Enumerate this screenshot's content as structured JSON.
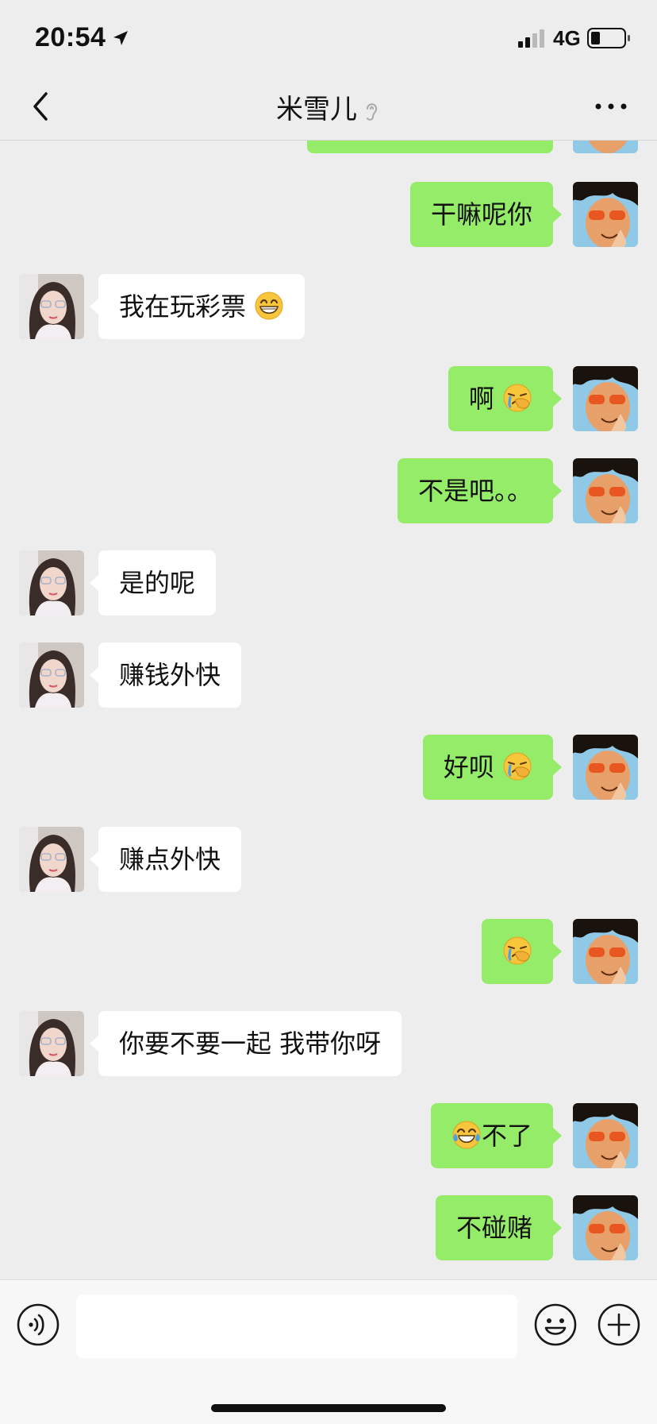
{
  "status_bar": {
    "time": "20:54",
    "network": "4G",
    "icons": [
      "location-arrow-icon",
      "signal-icon",
      "battery-icon"
    ]
  },
  "nav": {
    "title": "米雪儿",
    "icons": [
      "back-chevron-icon",
      "ear-icon",
      "more-dots-icon"
    ]
  },
  "messages": [
    {
      "side": "out",
      "text": "",
      "emoji": ""
    },
    {
      "side": "out",
      "text": "干嘛呢你",
      "emoji": ""
    },
    {
      "side": "in",
      "text": "我在玩彩票",
      "emoji": "grin"
    },
    {
      "side": "out",
      "text": "啊",
      "emoji": "facepalm"
    },
    {
      "side": "out",
      "text": "不是吧。。",
      "emoji": ""
    },
    {
      "side": "in",
      "text": "是的呢",
      "emoji": ""
    },
    {
      "side": "in",
      "text": "赚钱外快",
      "emoji": ""
    },
    {
      "side": "out",
      "text": "好呗",
      "emoji": "facepalm"
    },
    {
      "side": "in",
      "text": "赚点外快",
      "emoji": ""
    },
    {
      "side": "out",
      "text": "",
      "emoji": "facepalm"
    },
    {
      "side": "in",
      "text": "你要不要一起 我带你呀",
      "emoji": ""
    },
    {
      "side": "out",
      "text": "不了",
      "emoji": "tears-of-joy",
      "emoji_first": true
    },
    {
      "side": "out",
      "text": "不碰赌",
      "emoji": ""
    }
  ],
  "input_bar": {
    "input_value": "",
    "icons": [
      "voice-icon",
      "emoji-icon",
      "plus-icon"
    ]
  },
  "colors": {
    "background": "#ededed",
    "outgoing_bubble": "#95ec69",
    "incoming_bubble": "#ffffff",
    "input_bar": "#f7f7f7"
  }
}
